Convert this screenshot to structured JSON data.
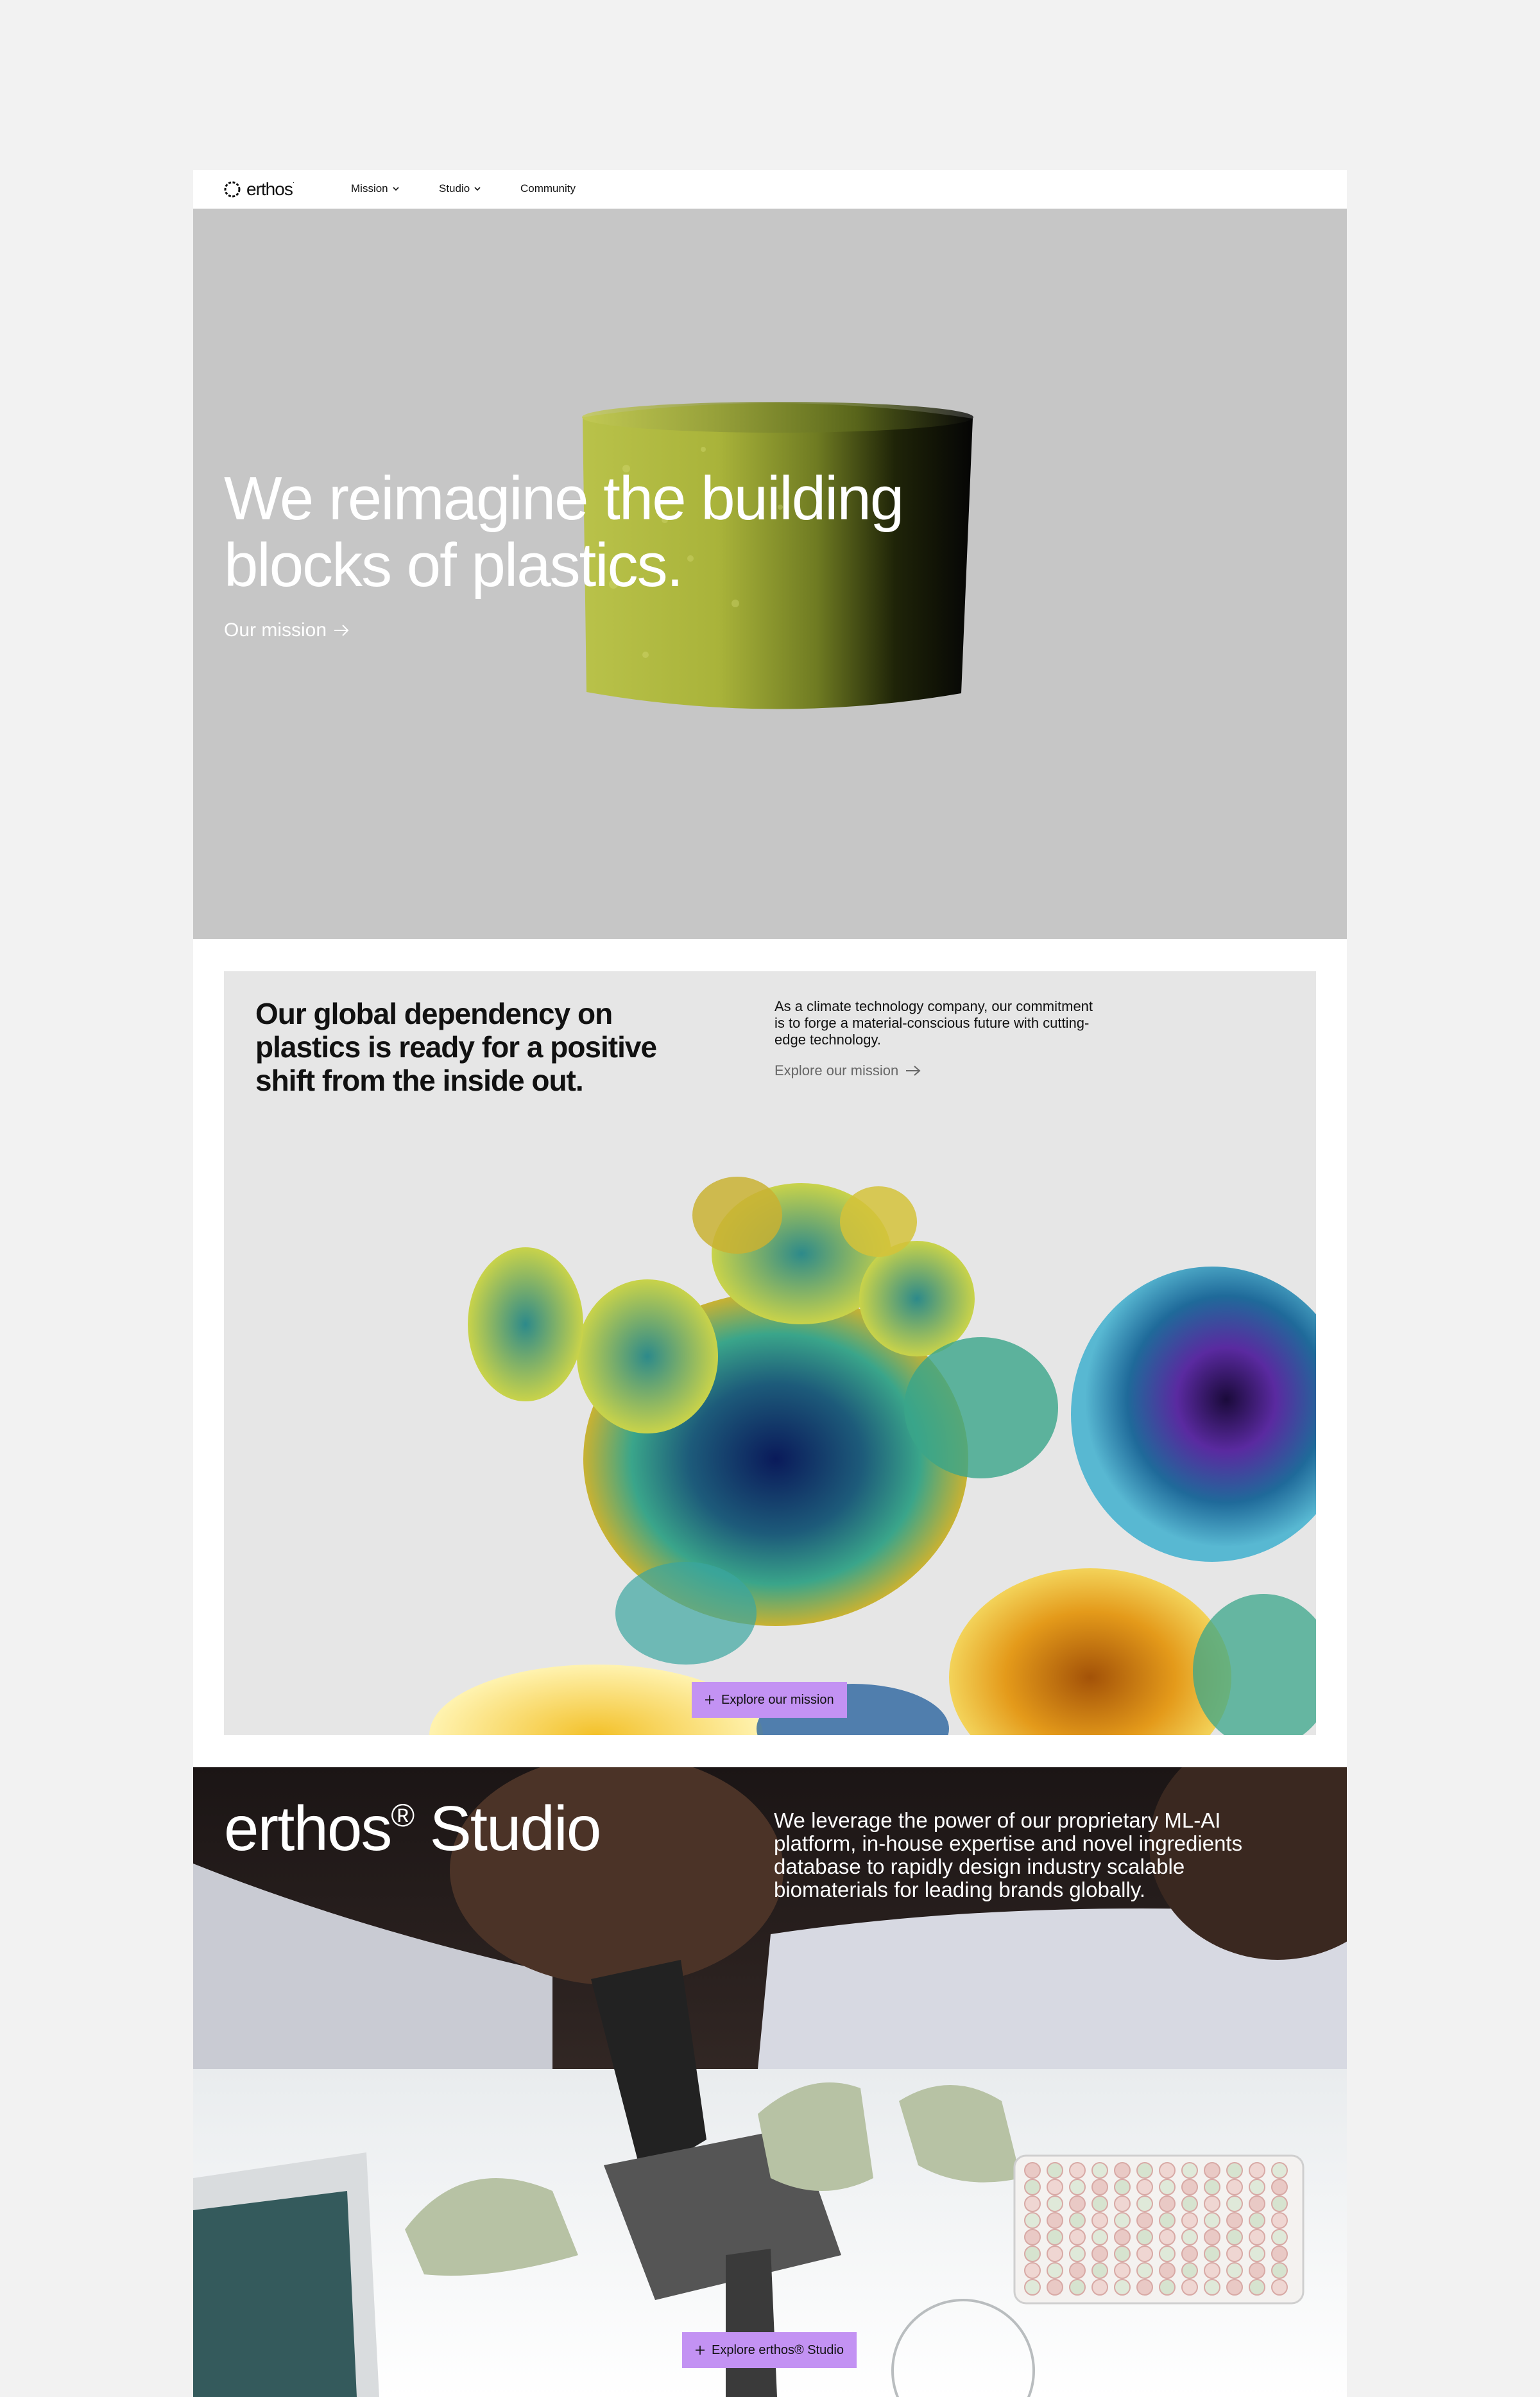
{
  "nav": {
    "logo": "erthos",
    "logo_mark": "·",
    "items": [
      {
        "label": "Mission",
        "has_dropdown": true
      },
      {
        "label": "Studio",
        "has_dropdown": true
      },
      {
        "label": "Community",
        "has_dropdown": false
      }
    ]
  },
  "hero": {
    "title_line1": "We reimagine the building",
    "title_line2": "blocks of plastics.",
    "link": "Our mission"
  },
  "mission": {
    "heading_line1": "Our global dependency on",
    "heading_line2": "plastics is ready for a positive",
    "heading_line3": "shift from the inside out.",
    "desc_line1": "As a climate technology company, our commitment",
    "desc_line2": "is to forge a material-conscious future with cutting-",
    "desc_line3": "edge technology.",
    "explore_link": "Explore our mission",
    "button": "Explore our mission"
  },
  "studio": {
    "title": "erthos",
    "title_reg": "®",
    "title_suffix": " Studio",
    "desc_line1": "We leverage the power of our proprietary ML-AI",
    "desc_line2": "platform, in-house expertise and novel ingredients",
    "desc_line3": "database to rapidly design industry scalable",
    "desc_line4": "biomaterials for leading brands globally.",
    "button": "Explore erthos® Studio"
  },
  "colors": {
    "page_bg": "#f2f2f2",
    "hero_bg": "#c6c6c6",
    "card_bg": "#e6e6e6",
    "accent": "#c392f3"
  }
}
